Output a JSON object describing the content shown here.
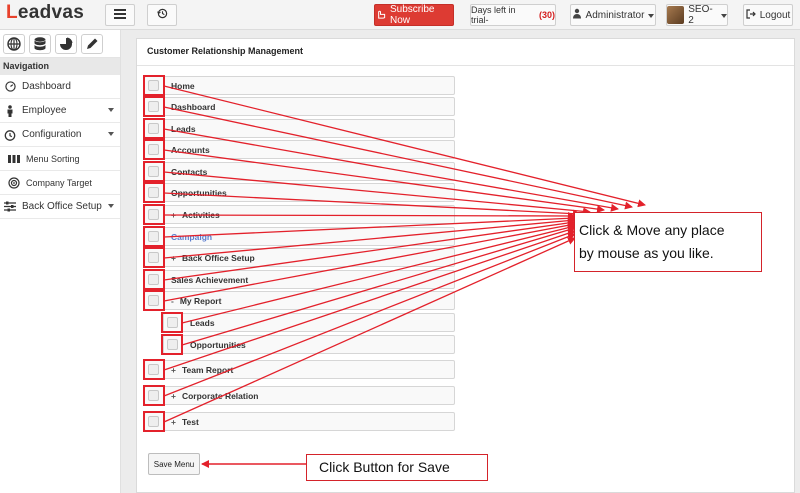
{
  "header": {
    "logo_text": "Leadvas",
    "menu_icon": "hamburger-icon",
    "history_icon": "history-icon",
    "subscribe_label": "Subscribe Now",
    "days_left_label": "Days left in trial-",
    "days_left_count": "(30)",
    "user_role": "Administrator",
    "org_name": "SEO-2",
    "logout_label": "Logout",
    "colors": {
      "brand_red": "#dd3b33",
      "accent_red": "#e8412c"
    }
  },
  "sidebar": {
    "quick_icons": [
      "globe-icon",
      "database-icon",
      "pie-chart-icon",
      "pencil-icon"
    ],
    "section_title": "Navigation",
    "items": [
      {
        "label": "Dashboard",
        "icon": "dashboard-icon",
        "caret": false,
        "sub": false
      },
      {
        "label": "Employee",
        "icon": "person-icon",
        "caret": true,
        "sub": false
      },
      {
        "label": "Configuration",
        "icon": "clock-icon",
        "caret": true,
        "sub": false
      },
      {
        "label": "Menu Sorting",
        "icon": "columns-icon",
        "caret": false,
        "sub": true
      },
      {
        "label": "Company Target",
        "icon": "target-icon",
        "caret": false,
        "sub": true
      },
      {
        "label": "Back Office Setup",
        "icon": "sliders-icon",
        "caret": true,
        "sub": false
      }
    ]
  },
  "main": {
    "panel_title": "Customer Relationship Management",
    "menu_rows": [
      {
        "label": "Home",
        "prefix": "",
        "child": false,
        "link": false
      },
      {
        "label": "Dashboard",
        "prefix": "",
        "child": false,
        "link": false
      },
      {
        "label": "Leads",
        "prefix": "",
        "child": false,
        "link": false
      },
      {
        "label": "Accounts",
        "prefix": "",
        "child": false,
        "link": false
      },
      {
        "label": "Contacts",
        "prefix": "",
        "child": false,
        "link": false
      },
      {
        "label": "Opportunities",
        "prefix": "",
        "child": false,
        "link": false
      },
      {
        "label": "Activities",
        "prefix": "+",
        "child": false,
        "link": false
      },
      {
        "label": "Campaign",
        "prefix": "",
        "child": false,
        "link": true
      },
      {
        "label": "Back Office Setup",
        "prefix": "+",
        "child": false,
        "link": false
      },
      {
        "label": "Sales Achievement",
        "prefix": "",
        "child": false,
        "link": false
      },
      {
        "label": "My Report",
        "prefix": "-",
        "child": false,
        "link": false
      },
      {
        "label": "Leads",
        "prefix": "",
        "child": true,
        "link": false
      },
      {
        "label": "Opportunities",
        "prefix": "",
        "child": true,
        "link": false
      },
      {
        "label": "Team Report",
        "prefix": "+",
        "child": false,
        "link": false
      },
      {
        "label": "Corporate Relation",
        "prefix": "+",
        "child": false,
        "link": false
      },
      {
        "label": "Test",
        "prefix": "+",
        "child": false,
        "link": false
      }
    ],
    "save_label": "Save Menu"
  },
  "annotations": {
    "drag_note_line1": "Click & Move any place",
    "drag_note_line2": "by mouse as you like.",
    "save_note": "Click Button for Save",
    "color": "#e3212b"
  }
}
